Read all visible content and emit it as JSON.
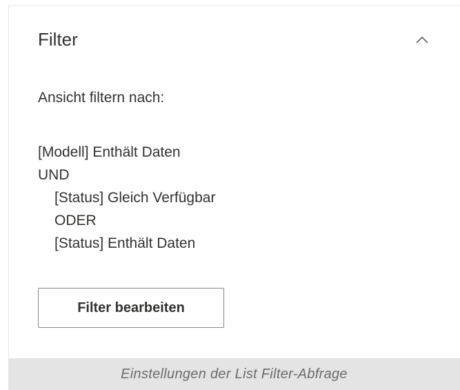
{
  "panel": {
    "title": "Filter",
    "collapse_icon": "chevron-up-icon",
    "heading": "Ansicht filtern nach:",
    "filter_lines": [
      "[Modell] Enthält Daten",
      "UND",
      "[Status] Gleich Verfügbar",
      "ODER",
      "[Status] Enthält Daten"
    ],
    "edit_button_label": "Filter bearbeiten"
  },
  "caption": {
    "text": "Einstellungen der List Filter-Abfrage"
  },
  "colors": {
    "text": "#323130",
    "button_border": "#8a8886",
    "caption_background": "#e4e4e4",
    "caption_text": "#6b6b6b"
  }
}
